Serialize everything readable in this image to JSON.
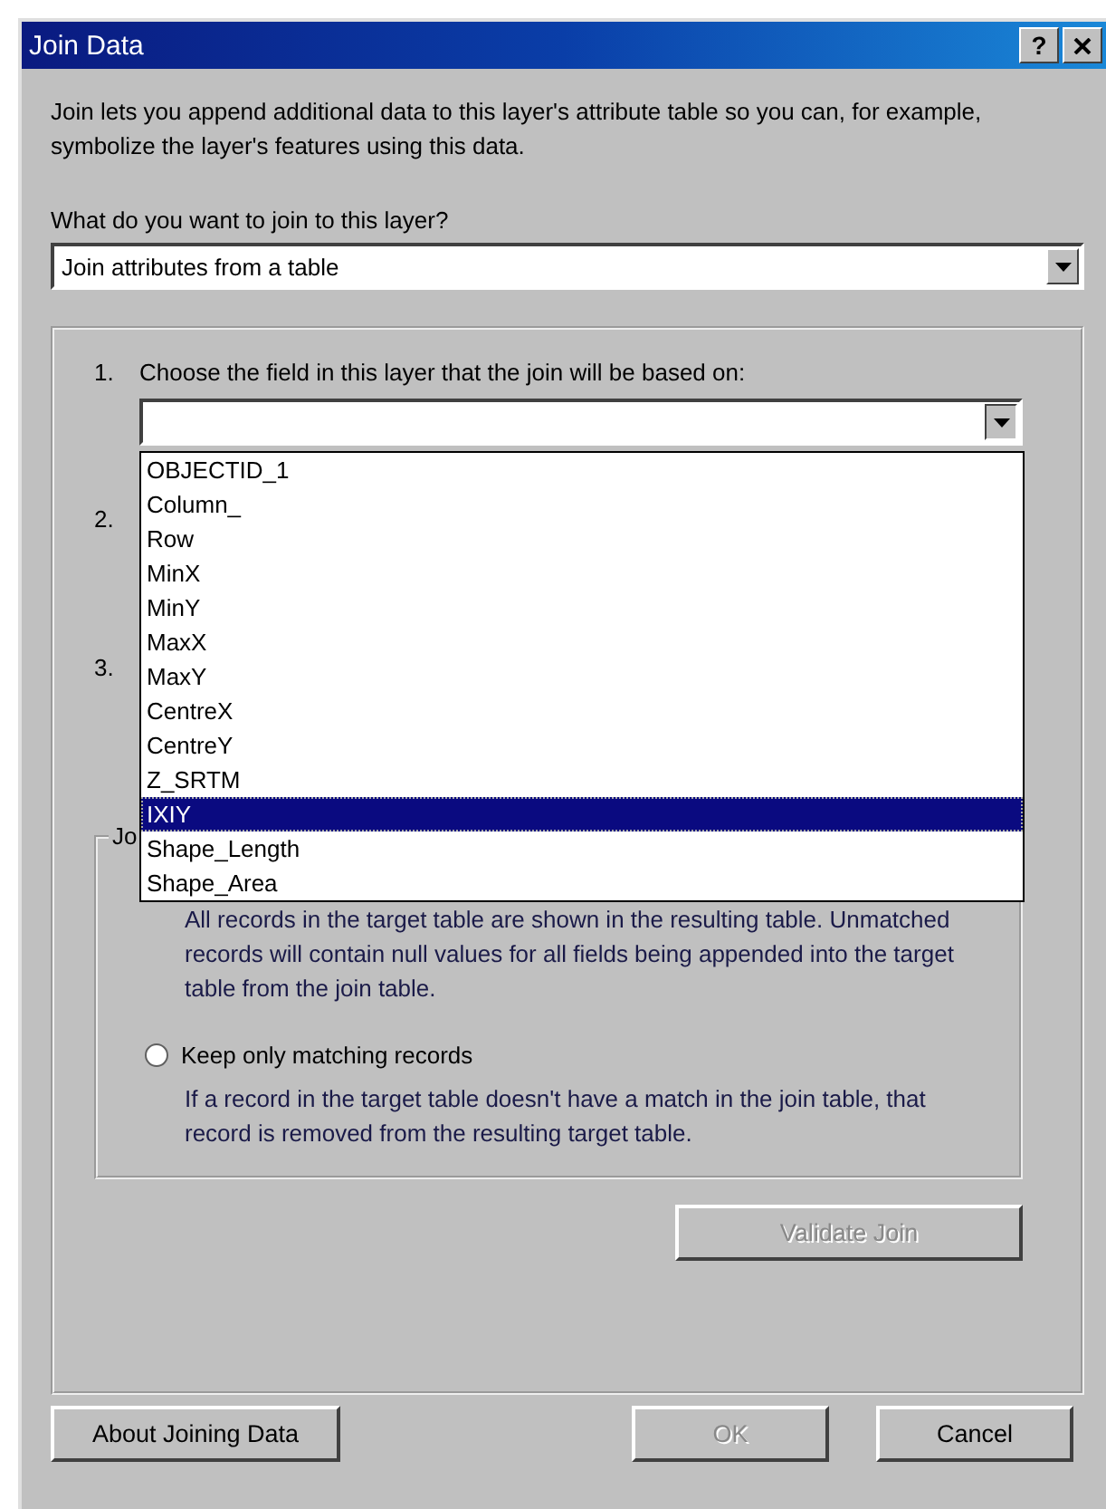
{
  "window": {
    "title": "Join Data",
    "help_button": "?"
  },
  "intro": "Join lets you append additional data to this layer's attribute table so you can, for example, symbolize the layer's features using this data.",
  "join_type": {
    "label": "What do you want to join to this layer?",
    "value": "Join attributes from a table"
  },
  "steps": [
    {
      "number": "1.",
      "label": "Choose the field in this layer that the join will be based on:"
    },
    {
      "number": "2."
    },
    {
      "number": "3."
    }
  ],
  "field_combo": {
    "expanded": true,
    "items": [
      {
        "label": "OBJECTID_1",
        "selected": false
      },
      {
        "label": "Column_",
        "selected": false
      },
      {
        "label": "Row",
        "selected": false
      },
      {
        "label": "MinX",
        "selected": false
      },
      {
        "label": "MinY",
        "selected": false
      },
      {
        "label": "MaxX",
        "selected": false
      },
      {
        "label": "MaxY",
        "selected": false
      },
      {
        "label": "CentreX",
        "selected": false
      },
      {
        "label": "CentreY",
        "selected": false
      },
      {
        "label": "Z_SRTM",
        "selected": false
      },
      {
        "label": "IXIY",
        "selected": true
      },
      {
        "label": "Shape_Length",
        "selected": false
      },
      {
        "label": "Shape_Area",
        "selected": false
      }
    ]
  },
  "join_options": {
    "legend": "Jo",
    "options": [
      {
        "description": "All records in the target table are shown in the resulting table. Unmatched records will contain null values for all fields being appended into the target table from the join table."
      },
      {
        "label": "Keep only matching records",
        "checked": false,
        "description": "If a record in the target table doesn't have a match in the join table, that record is removed from the resulting target table."
      }
    ]
  },
  "validate_button": {
    "label": "Validate Join",
    "disabled": true
  },
  "buttons": [
    {
      "label": "About Joining Data",
      "disabled": false
    },
    {
      "label": "OK",
      "disabled": true
    },
    {
      "label": "Cancel",
      "disabled": false
    }
  ]
}
